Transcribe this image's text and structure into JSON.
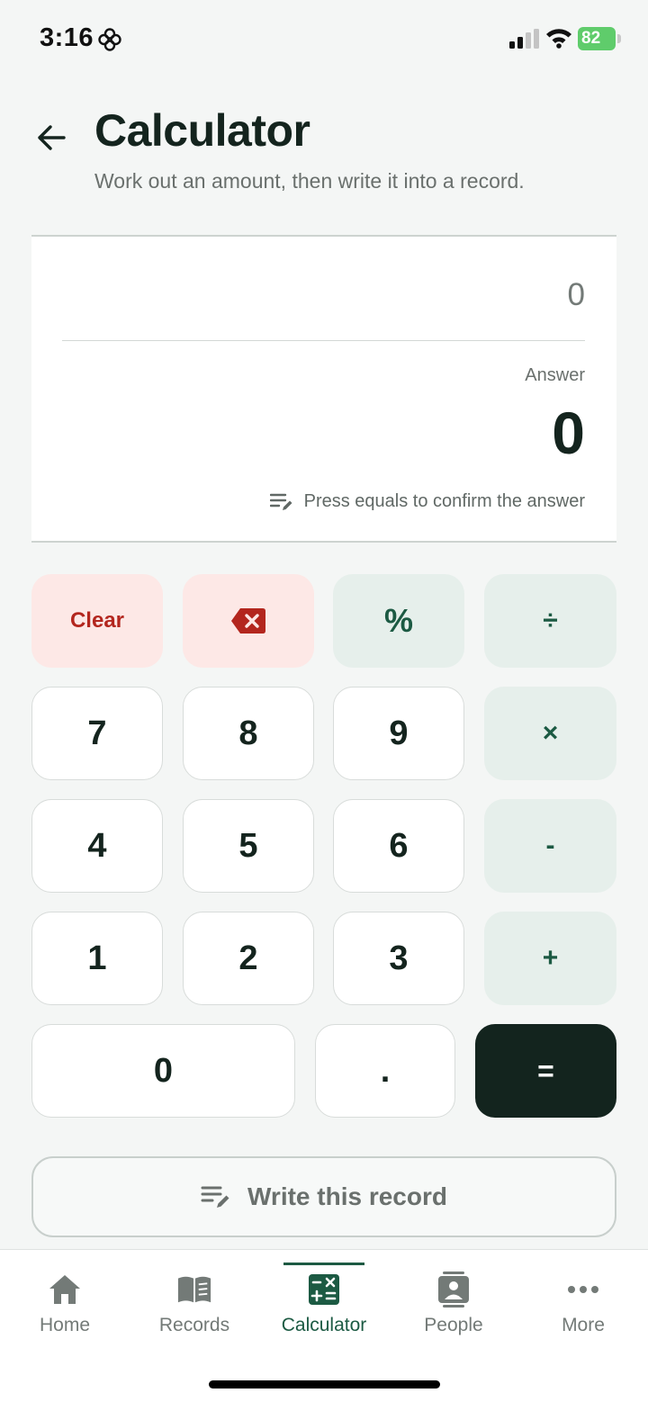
{
  "status_bar": {
    "time": "3:16",
    "battery": "82"
  },
  "header": {
    "title": "Calculator",
    "subtitle": "Work out an amount, then write it into a record."
  },
  "display": {
    "expression": "0",
    "answer_label": "Answer",
    "answer_value": "0",
    "hint": "Press equals to confirm the answer"
  },
  "keypad": {
    "clear": "Clear",
    "percent": "%",
    "divide": "÷",
    "multiply": "×",
    "minus": "-",
    "plus": "+",
    "equals": "=",
    "dot": ".",
    "digits": {
      "d0": "0",
      "d1": "1",
      "d2": "2",
      "d3": "3",
      "d4": "4",
      "d5": "5",
      "d6": "6",
      "d7": "7",
      "d8": "8",
      "d9": "9"
    }
  },
  "write_button": {
    "label": "Write this record"
  },
  "nav": {
    "items": [
      {
        "label": "Home"
      },
      {
        "label": "Records"
      },
      {
        "label": "Calculator"
      },
      {
        "label": "People"
      },
      {
        "label": "More"
      }
    ]
  },
  "colors": {
    "accent": "#1c5a43",
    "equals_bg": "#13241e",
    "danger": "#b3261e",
    "danger_bg": "#fde8e6",
    "operator_bg": "#e6efeb",
    "battery": "#5fcc6b"
  }
}
